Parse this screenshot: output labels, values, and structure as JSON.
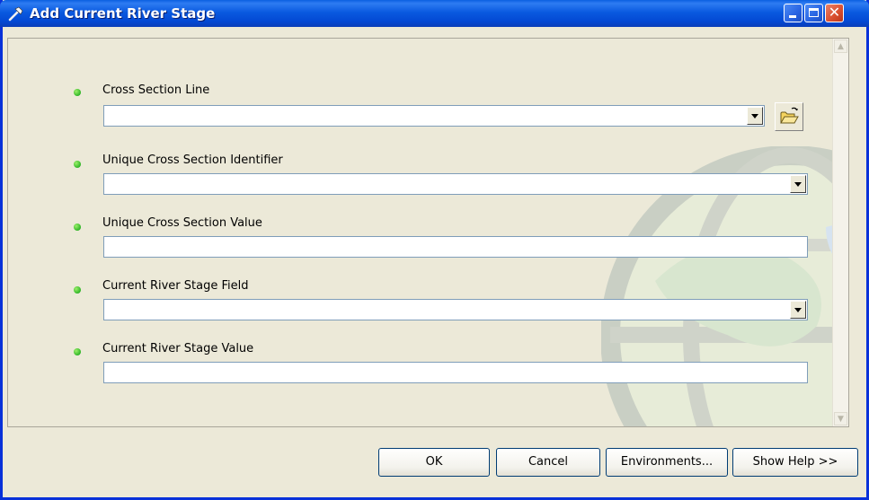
{
  "window": {
    "title": "Add Current River Stage",
    "title_icon": "hammer-icon"
  },
  "params": [
    {
      "label": "Cross Section Line",
      "type": "dropdown-browse",
      "value": "",
      "status_color": "#2fb526"
    },
    {
      "label": "Unique Cross Section Identifier",
      "type": "dropdown",
      "value": "",
      "status_color": "#2fb526"
    },
    {
      "label": "Unique Cross Section Value",
      "type": "text",
      "value": "",
      "status_color": "#2fb526"
    },
    {
      "label": "Current River Stage Field",
      "type": "dropdown",
      "value": "",
      "status_color": "#2fb526"
    },
    {
      "label": "Current River Stage Value",
      "type": "text",
      "value": "",
      "status_color": "#2fb526"
    }
  ],
  "buttons": {
    "ok": "OK",
    "cancel": "Cancel",
    "environments": "Environments...",
    "show_help": "Show Help >>"
  },
  "colors": {
    "titlebar": "#0a5ae0",
    "frame": "#ece9d8",
    "close_button": "#d94e2e"
  }
}
